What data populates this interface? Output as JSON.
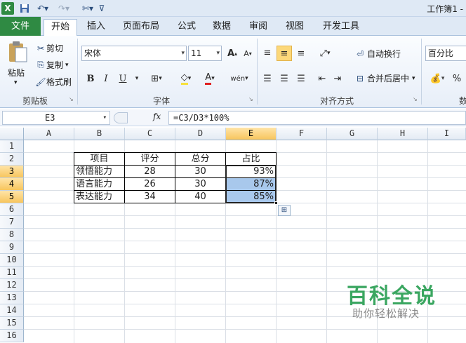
{
  "window": {
    "title": "工作簿1 -"
  },
  "quick_access": {
    "save_icon": "save-icon",
    "undo_icon": "undo-icon",
    "redo_icon": "redo-icon",
    "customize_icon": "customize-icon"
  },
  "tabs": [
    "文件",
    "开始",
    "插入",
    "页面布局",
    "公式",
    "数据",
    "审阅",
    "视图",
    "开发工具"
  ],
  "ribbon": {
    "clipboard": {
      "paste": "粘贴",
      "cut": "剪切",
      "copy": "复制",
      "format_painter": "格式刷",
      "group": "剪贴板"
    },
    "font": {
      "name": "宋体",
      "size": "11",
      "bold": "B",
      "italic": "I",
      "underline": "U",
      "group": "字体"
    },
    "alignment": {
      "wrap_text": "自动换行",
      "merge_center": "合并后居中",
      "group": "对齐方式"
    },
    "number": {
      "format": "百分比",
      "percent": "%",
      "group": "数"
    }
  },
  "formula_bar": {
    "name_box": "E3",
    "fx": "fx",
    "formula": "=C3/D3*100%"
  },
  "sheet": {
    "columns": [
      "A",
      "B",
      "C",
      "D",
      "E",
      "F",
      "G",
      "H",
      "I"
    ],
    "rows": [
      "1",
      "2",
      "3",
      "4",
      "5",
      "6",
      "7",
      "8",
      "9",
      "10",
      "11",
      "12",
      "13",
      "14",
      "15",
      "16"
    ],
    "table_headers": [
      "项目",
      "评分",
      "总分",
      "占比"
    ],
    "table_rows": [
      [
        "领悟能力",
        "28",
        "30",
        "93%"
      ],
      [
        "语言能力",
        "26",
        "30",
        "87%"
      ],
      [
        "表达能力",
        "34",
        "40",
        "85%"
      ]
    ],
    "selection": "E3:E5",
    "accent_color": "#a8c8ec"
  },
  "watermark": {
    "title": "百科全说",
    "subtitle": "助你轻松解决"
  }
}
